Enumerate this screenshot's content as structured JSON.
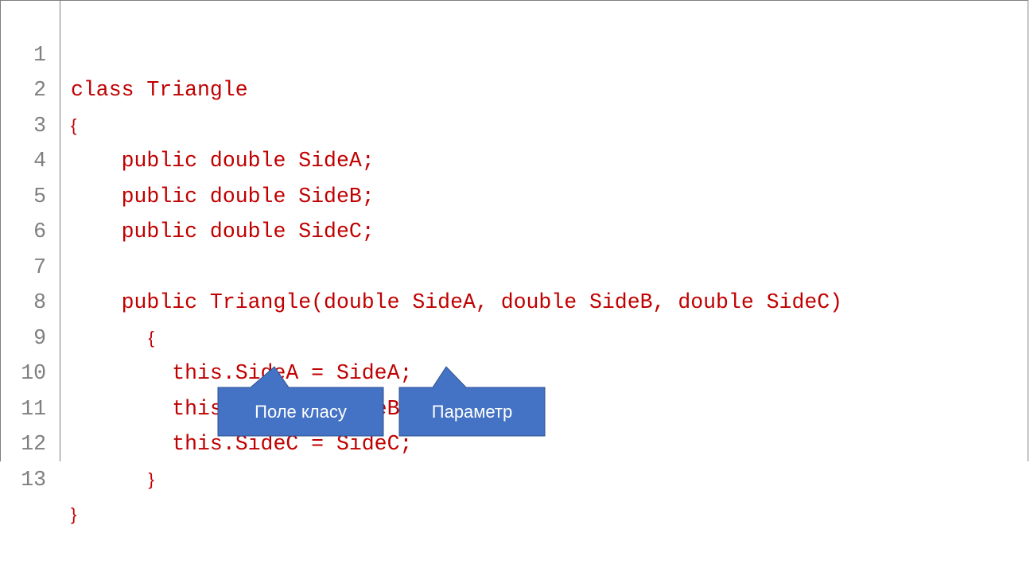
{
  "code": {
    "lines": [
      {
        "number": "1",
        "text": "class Triangle"
      },
      {
        "number": "2",
        "text": "{"
      },
      {
        "number": "3",
        "text": "    public double SideA;"
      },
      {
        "number": "4",
        "text": "    public double SideB;"
      },
      {
        "number": "5",
        "text": "    public double SideC;"
      },
      {
        "number": "6",
        "text": ""
      },
      {
        "number": "7",
        "text": "    public Triangle(double SideA, double SideB, double SideC)"
      },
      {
        "number": "8",
        "text": "    {"
      },
      {
        "number": "9",
        "text": "        this.SideA = SideA;"
      },
      {
        "number": "10",
        "text": "        this.SideB = SideB;"
      },
      {
        "number": "11",
        "text": "        this.SideC = SideC;"
      },
      {
        "number": "12",
        "text": "    }"
      },
      {
        "number": "13",
        "text": "}"
      }
    ]
  },
  "callouts": {
    "field": "Поле класу",
    "parameter": "Параметр"
  },
  "colors": {
    "code_text": "#c00000",
    "line_numbers": "#7f7f7f",
    "callout_fill": "#4472c4",
    "callout_border": "#2f528f"
  }
}
